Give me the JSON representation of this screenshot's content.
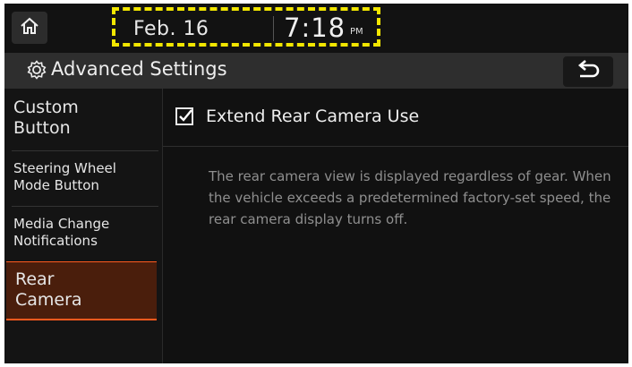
{
  "status_bar": {
    "date": "Feb. 16",
    "time": "7:18",
    "ampm": "PM",
    "home_icon": "home-icon",
    "highlight_color": "#f2e600"
  },
  "title_bar": {
    "title": "Advanced Settings",
    "settings_icon": "gear-icon",
    "back_icon": "back-arrow-icon"
  },
  "sidebar": {
    "items": [
      {
        "label_line1": "Custom",
        "label_line2": "Button",
        "active": false
      },
      {
        "label_line1": "Steering Wheel",
        "label_line2": "Mode Button",
        "active": false
      },
      {
        "label_line1": "Media Change",
        "label_line2": "Notifications",
        "active": false
      },
      {
        "label_line1": "Rear",
        "label_line2": "Camera",
        "active": true
      }
    ],
    "active_color": "#ff5a1e"
  },
  "content": {
    "option_label": "Extend Rear Camera Use",
    "option_checked": true,
    "description": "The rear camera view is displayed regardless of gear. When the vehicle exceeds a predetermined factory-set speed, the rear camera display turns off."
  }
}
